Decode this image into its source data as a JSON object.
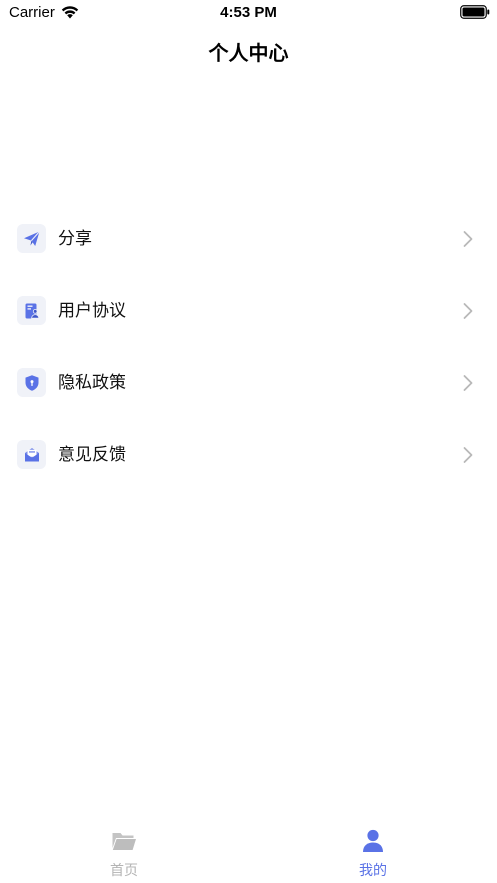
{
  "status_bar": {
    "carrier": "Carrier",
    "time": "4:53 PM"
  },
  "nav": {
    "title": "个人中心"
  },
  "menu": {
    "items": [
      {
        "label": "分享",
        "icon": "paper-plane-icon"
      },
      {
        "label": "用户协议",
        "icon": "user-agreement-icon"
      },
      {
        "label": "隐私政策",
        "icon": "shield-icon"
      },
      {
        "label": "意见反馈",
        "icon": "envelope-icon"
      }
    ]
  },
  "tab_bar": {
    "tabs": [
      {
        "label": "首页",
        "icon": "folder-icon",
        "active": false
      },
      {
        "label": "我的",
        "icon": "user-icon",
        "active": true
      }
    ]
  },
  "colors": {
    "accent": "#5a72e6",
    "icon_bg": "#f0f2f8",
    "inactive_tab": "#b4b4b4",
    "chevron": "#b8b8b8"
  }
}
